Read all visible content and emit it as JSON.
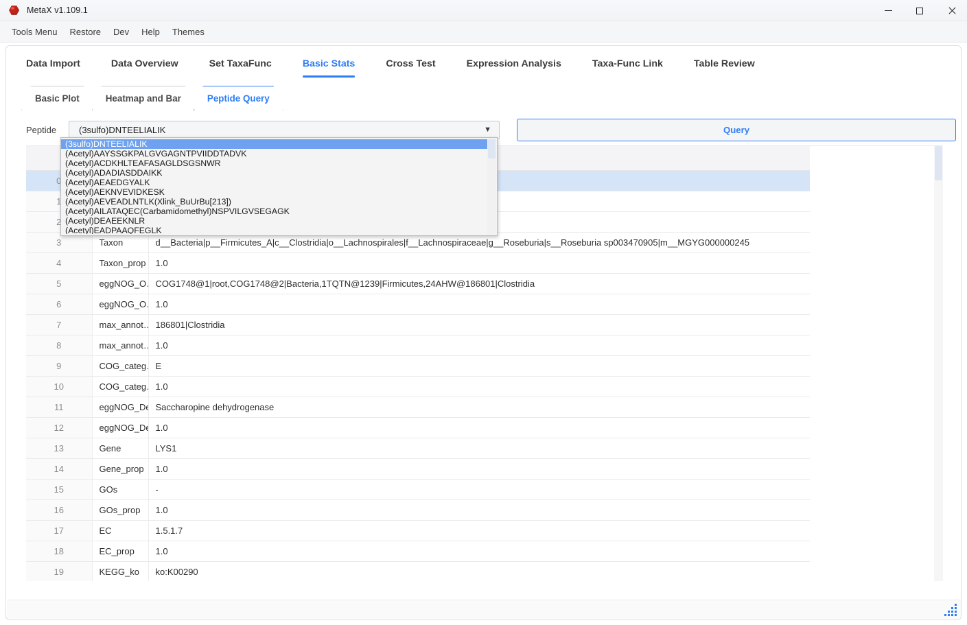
{
  "window": {
    "title": "MetaX v1.109.1",
    "icon": "app-hexagon-icon",
    "controls": {
      "minimize": "minimize",
      "maximize": "maximize",
      "close": "close"
    }
  },
  "menubar": {
    "items": [
      "Tools Menu",
      "Restore",
      "Dev",
      "Help",
      "Themes"
    ]
  },
  "main_tabs": {
    "items": [
      {
        "label": "Data Import",
        "active": false
      },
      {
        "label": "Data Overview",
        "active": false
      },
      {
        "label": "Set TaxaFunc",
        "active": false
      },
      {
        "label": "Basic Stats",
        "active": true
      },
      {
        "label": "Cross Test",
        "active": false
      },
      {
        "label": "Expression Analysis",
        "active": false
      },
      {
        "label": "Taxa-Func Link",
        "active": false
      },
      {
        "label": "Table Review",
        "active": false
      }
    ]
  },
  "sub_tabs": {
    "items": [
      {
        "label": "Basic Plot",
        "active": false
      },
      {
        "label": "Heatmap and Bar",
        "active": false
      },
      {
        "label": "Peptide Query",
        "active": true
      }
    ]
  },
  "peptide_selector": {
    "label": "Peptide",
    "value": "(3sulfo)DNTEELIALIK",
    "arrow_icon": "chevron-down-icon",
    "expanded": true,
    "options": [
      "(3sulfo)DNTEELIALIK",
      "(Acetyl)AAYSSGKPALGVGAGNTPVIIDDTADVK",
      "(Acetyl)ACDKHLTEAFASAGLDSGSNWR",
      "(Acetyl)ADADIASDDAIKK",
      "(Acetyl)AEAEDGYALK",
      "(Acetyl)AEKNVEVIDKESK",
      "(Acetyl)AEVEADLNTLK(Xlink_BuUrBu[213])",
      "(Acetyl)AILATAQEC(Carbamidomethyl)NSPVILGVSEGAGK",
      "(Acetyl)DEAEEKNLR",
      "(Acetyl)EADPAAQFEGLK"
    ],
    "selected_index": 0
  },
  "query_button": {
    "label": "Query"
  },
  "result_table": {
    "headers": [
      "",
      "",
      ""
    ],
    "rows": [
      {
        "index": "0",
        "key": "",
        "value": "",
        "selected": true,
        "hidden_by_popup": true
      },
      {
        "index": "1",
        "key": "",
        "value": "",
        "selected": false,
        "hidden_by_popup": true
      },
      {
        "index": "2",
        "key": "",
        "value": "",
        "selected": false,
        "hidden_by_popup": true
      },
      {
        "index": "3",
        "key": "Taxon",
        "value": "d__Bacteria|p__Firmicutes_A|c__Clostridia|o__Lachnospirales|f__Lachnospiraceae|g__Roseburia|s__Roseburia sp003470905|m__MGYG000000245",
        "selected": false
      },
      {
        "index": "4",
        "key": "Taxon_prop",
        "value": "1.0",
        "selected": false
      },
      {
        "index": "5",
        "key": "eggNOG_O…",
        "value": "COG1748@1|root,COG1748@2|Bacteria,1TQTN@1239|Firmicutes,24AHW@186801|Clostridia",
        "selected": false
      },
      {
        "index": "6",
        "key": "eggNOG_O…",
        "value": "1.0",
        "selected": false
      },
      {
        "index": "7",
        "key": "max_annot…",
        "value": "186801|Clostridia",
        "selected": false
      },
      {
        "index": "8",
        "key": "max_annot…",
        "value": "1.0",
        "selected": false
      },
      {
        "index": "9",
        "key": "COG_categ…",
        "value": "E",
        "selected": false
      },
      {
        "index": "10",
        "key": "COG_categ…",
        "value": "1.0",
        "selected": false
      },
      {
        "index": "11",
        "key": "eggNOG_De…",
        "value": "Saccharopine dehydrogenase",
        "selected": false
      },
      {
        "index": "12",
        "key": "eggNOG_De…",
        "value": "1.0",
        "selected": false
      },
      {
        "index": "13",
        "key": "Gene",
        "value": "LYS1",
        "selected": false
      },
      {
        "index": "14",
        "key": "Gene_prop",
        "value": "1.0",
        "selected": false
      },
      {
        "index": "15",
        "key": "GOs",
        "value": "-",
        "selected": false
      },
      {
        "index": "16",
        "key": "GOs_prop",
        "value": "1.0",
        "selected": false
      },
      {
        "index": "17",
        "key": "EC",
        "value": "1.5.1.7",
        "selected": false
      },
      {
        "index": "18",
        "key": "EC_prop",
        "value": "1.0",
        "selected": false
      },
      {
        "index": "19",
        "key": "KEGG_ko",
        "value": "ko:K00290",
        "selected": false
      }
    ]
  },
  "colors": {
    "accent": "#2f7df6",
    "selection_row": "#d6e4f7",
    "dropdown_highlight": "#6ea2f0",
    "app_icon": "#c0241b"
  }
}
